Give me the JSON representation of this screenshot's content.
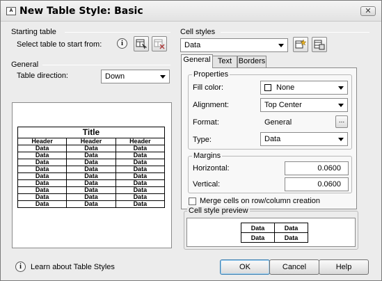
{
  "window": {
    "title": "New Table Style: Basic",
    "icon_text": "A",
    "close_symbol": "✕"
  },
  "starting_table": {
    "group_label": "Starting table",
    "select_label": "Select table to start from:",
    "icons": [
      "info-icon",
      "select-table-icon",
      "remove-table-icon"
    ]
  },
  "general": {
    "group_label": "General",
    "direction_label": "Table direction:",
    "direction_value": "Down"
  },
  "table_preview": {
    "title": "Title",
    "headers": [
      "Header",
      "Header",
      "Header"
    ],
    "rows": [
      [
        "Data",
        "Data",
        "Data"
      ],
      [
        "Data",
        "Data",
        "Data"
      ],
      [
        "Data",
        "Data",
        "Data"
      ],
      [
        "Data",
        "Data",
        "Data"
      ],
      [
        "Data",
        "Data",
        "Data"
      ],
      [
        "Data",
        "Data",
        "Data"
      ],
      [
        "Data",
        "Data",
        "Data"
      ],
      [
        "Data",
        "Data",
        "Data"
      ],
      [
        "Data",
        "Data",
        "Data"
      ]
    ]
  },
  "cell_styles": {
    "group_label": "Cell styles",
    "selected": "Data",
    "icons": [
      "new-cell-style-icon",
      "manage-cell-styles-icon"
    ]
  },
  "tabs": [
    "General",
    "Text",
    "Borders"
  ],
  "properties": {
    "group_label": "Properties",
    "fill_color_label": "Fill color:",
    "fill_color_value": "None",
    "alignment_label": "Alignment:",
    "alignment_value": "Top Center",
    "format_label": "Format:",
    "format_value": "General",
    "format_button": "...",
    "type_label": "Type:",
    "type_value": "Data"
  },
  "margins": {
    "group_label": "Margins",
    "horizontal_label": "Horizontal:",
    "horizontal_value": "0.0600",
    "vertical_label": "Vertical:",
    "vertical_value": "0.0600"
  },
  "merge_label": "Merge cells on row/column creation",
  "merge_checked": false,
  "cell_style_preview": {
    "group_label": "Cell style preview",
    "rows": [
      [
        "Data",
        "Data"
      ],
      [
        "Data",
        "Data"
      ]
    ]
  },
  "footer": {
    "learn_link": "Learn about Table Styles",
    "ok": "OK",
    "cancel": "Cancel",
    "help": "Help"
  }
}
